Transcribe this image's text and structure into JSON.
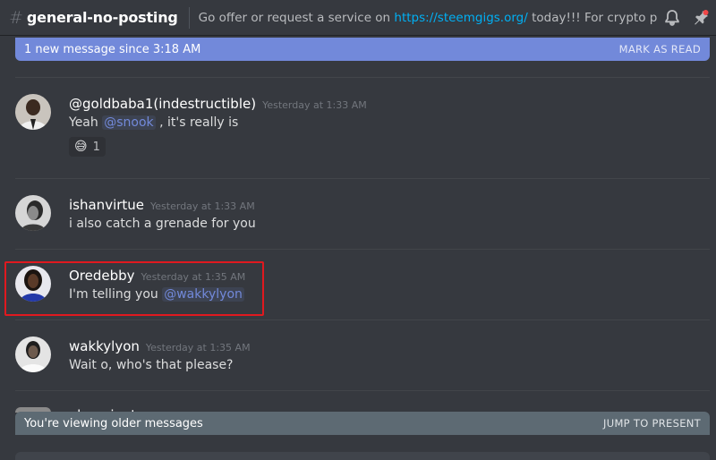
{
  "header": {
    "channel_hash": "#",
    "channel_name": "general-no-posting",
    "topic_prefix": "Go offer or request a service on ",
    "topic_link": "https://steemgigs.org/",
    "topic_suffix": " today!!! For crypto prices use..."
  },
  "icons": {
    "bell": "bell-icon",
    "pin": "pin-icon"
  },
  "new_message_bar": {
    "text": "1 new message since 3:18 AM",
    "action": "MARK AS READ"
  },
  "messages": [
    {
      "username": "@goldbaba1(indestructible)",
      "timestamp": "Yesterday at 1:33 AM",
      "text_before": "Yeah ",
      "mention": "@snook",
      "text_after": " , it's really is",
      "reaction": {
        "emoji": "😅",
        "count": "1"
      }
    },
    {
      "username": "ishanvirtue",
      "timestamp": "Yesterday at 1:33 AM",
      "text_before": "i also catch a grenade for you"
    },
    {
      "username": "Oredebby",
      "timestamp": "Yesterday at 1:35 AM",
      "text_before": "I'm telling you ",
      "mention": "@wakkylyon"
    },
    {
      "username": "wakkylyon",
      "timestamp": "Yesterday at 1:35 AM",
      "text_before": "Wait o, who's that please?"
    }
  ],
  "partial_username": "olan...ient...",
  "older_bar": {
    "text": "You're viewing older messages",
    "action": "JUMP TO PRESENT"
  },
  "colors": {
    "background": "#36393f",
    "accent": "#7289da",
    "link": "#00b0f4",
    "highlight": "#e0191f"
  }
}
